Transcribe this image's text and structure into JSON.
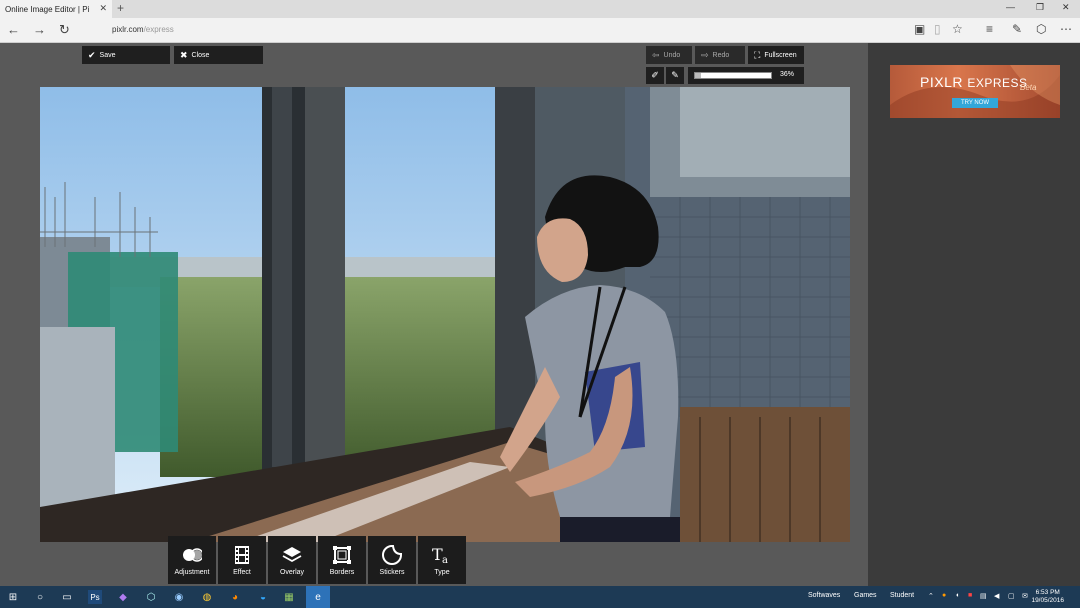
{
  "browser": {
    "tab_title": "Online Image Editor | Pi",
    "tab_close": "✕",
    "new_tab": "+",
    "url_host": "pixlr.com",
    "url_path": "/express"
  },
  "editor": {
    "save_label": "Save",
    "close_label": "Close",
    "undo_label": "Undo",
    "redo_label": "Redo",
    "fullscreen_label": "Fullscreen",
    "zoom_text": "36%",
    "zoom_fraction": 0.08
  },
  "ad": {
    "brand": "PIXLR",
    "product": "EXPRESS",
    "beta": "Beta",
    "cta": "TRY NOW"
  },
  "tools": [
    {
      "label": "Adjustment",
      "icon": "adjustment-icon"
    },
    {
      "label": "Effect",
      "icon": "effect-film-icon"
    },
    {
      "label": "Overlay",
      "icon": "overlay-layers-icon"
    },
    {
      "label": "Borders",
      "icon": "borders-icon"
    },
    {
      "label": "Stickers",
      "icon": "stickers-icon"
    },
    {
      "label": "Type",
      "icon": "type-icon"
    }
  ],
  "taskbar": {
    "tray": [
      "Softwaves",
      "Games",
      "Student"
    ],
    "time": "6:53 PM",
    "date": "19/05/2016"
  },
  "colors": {
    "app_bg": "#595959",
    "side_bg": "#3b3b3b",
    "button_bg": "#1f1f1f",
    "taskbar_bg": "#1d3a55",
    "ad_button": "#33a7d9"
  }
}
